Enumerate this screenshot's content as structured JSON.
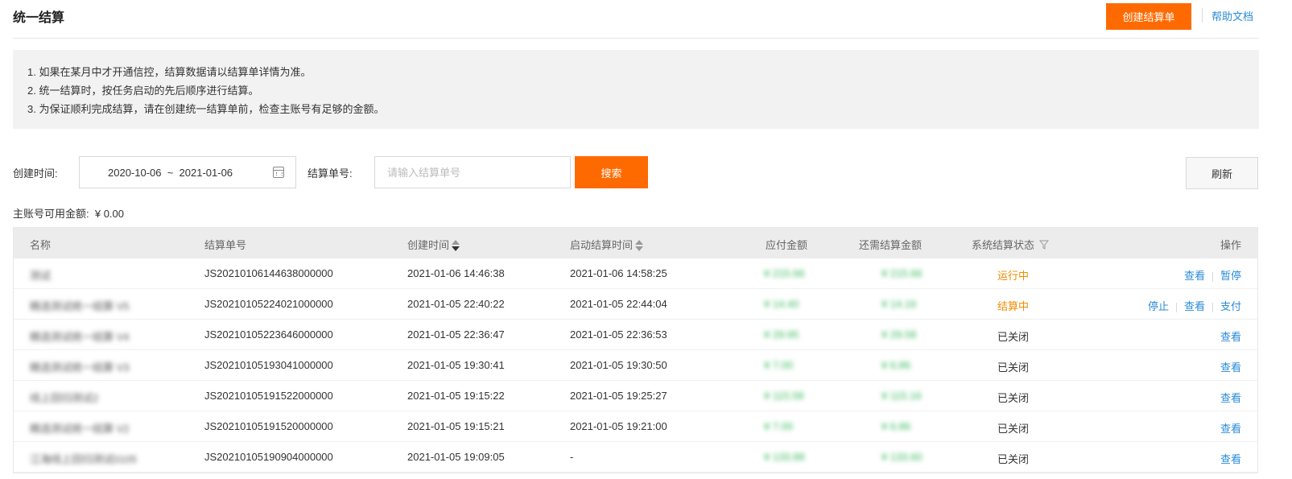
{
  "header": {
    "title": "统一结算",
    "create_button": "创建结算单",
    "help_link": "帮助文档"
  },
  "notice": {
    "lines": [
      "1. 如果在某月中才开通信控，结算数据请以结算单详情为准。",
      "2. 统一结算时，按任务启动的先后顺序进行结算。",
      "3. 为保证顺利完成结算，请在创建统一结算单前，检查主账号有足够的金额。"
    ]
  },
  "filters": {
    "created_time_label": "创建时间:",
    "date_range": "2020-10-06  ~  2021-01-06",
    "settlement_no_label": "结算单号:",
    "settlement_no_placeholder": "请输入结算单号",
    "search_button": "搜索",
    "refresh_button": "刷新"
  },
  "balance": {
    "label": "主账号可用金额:",
    "value": "¥ 0.00"
  },
  "table": {
    "headers": {
      "name": "名称",
      "settlement_no": "结算单号",
      "created_time": "创建时间",
      "start_time": "启动结算时间",
      "payable": "应付金额",
      "remaining": "还需结算金额",
      "status": "系统结算状态",
      "actions": "操作"
    },
    "rows": [
      {
        "name": "测试",
        "no": "JS20210106144638000000",
        "created": "2021-01-06 14:46:38",
        "started": "2021-01-06 14:58:25",
        "payable": "¥ 215.66",
        "remaining": "¥ 215.66",
        "status": "运行中",
        "status_type": "running",
        "actions": [
          "查看",
          "暂停"
        ]
      },
      {
        "name": "精选测试统一结算 V5",
        "no": "JS20210105224021000000",
        "created": "2021-01-05 22:40:22",
        "started": "2021-01-05 22:44:04",
        "payable": "¥ 14.40",
        "remaining": "¥ 14.16",
        "status": "结算中",
        "status_type": "running",
        "actions": [
          "停止",
          "查看",
          "支付"
        ]
      },
      {
        "name": "精选测试统一结算 V4",
        "no": "JS20210105223646000000",
        "created": "2021-01-05 22:36:47",
        "started": "2021-01-05 22:36:53",
        "payable": "¥ 29.95",
        "remaining": "¥ 29.58",
        "status": "已关闭",
        "status_type": "closed",
        "actions": [
          "查看"
        ]
      },
      {
        "name": "精选测试统一结算 V3",
        "no": "JS20210105193041000000",
        "created": "2021-01-05 19:30:41",
        "started": "2021-01-05 19:30:50",
        "payable": "¥ 7.00",
        "remaining": "¥ 6.86",
        "status": "已关闭",
        "status_type": "closed",
        "actions": [
          "查看"
        ]
      },
      {
        "name": "线上回归测试2",
        "no": "JS20210105191522000000",
        "created": "2021-01-05 19:15:22",
        "started": "2021-01-05 19:25:27",
        "payable": "¥ 115.58",
        "remaining": "¥ 115.16",
        "status": "已关闭",
        "status_type": "closed",
        "actions": [
          "查看"
        ]
      },
      {
        "name": "精选测试统一结算 V2",
        "no": "JS20210105191520000000",
        "created": "2021-01-05 19:15:21",
        "started": "2021-01-05 19:21:00",
        "payable": "¥ 7.00",
        "remaining": "¥ 6.86",
        "status": "已关闭",
        "status_type": "closed",
        "actions": [
          "查看"
        ]
      },
      {
        "name": "江海线上回归测试0105",
        "no": "JS20210105190904000000",
        "created": "2021-01-05 19:09:05",
        "started": "-",
        "payable": "¥ 133.88",
        "remaining": "¥ 133.60",
        "status": "已关闭",
        "status_type": "closed",
        "actions": [
          "查看"
        ]
      }
    ]
  },
  "colors": {
    "brand_orange": "#ff6a00",
    "link_blue": "#2a8bd8",
    "amount_green": "#35b858",
    "status_orange": "#f08c00"
  }
}
